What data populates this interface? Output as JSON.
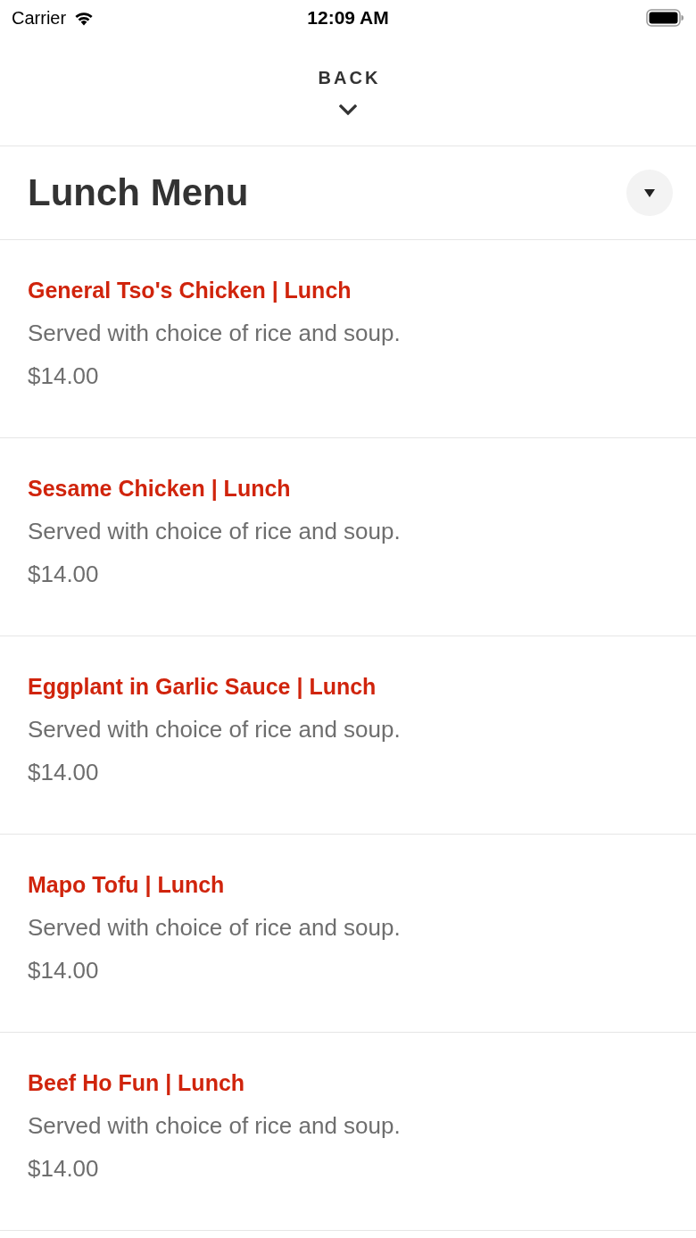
{
  "status_bar": {
    "carrier": "Carrier",
    "time": "12:09 AM"
  },
  "back": {
    "label": "BACK"
  },
  "header": {
    "title": "Lunch Menu"
  },
  "items": [
    {
      "name": "General Tso's Chicken | Lunch",
      "description": "Served with choice of rice and soup.",
      "price": "$14.00"
    },
    {
      "name": "Sesame Chicken | Lunch",
      "description": "Served with choice of rice and soup.",
      "price": "$14.00"
    },
    {
      "name": "Eggplant in Garlic Sauce | Lunch",
      "description": "Served with choice of rice and soup.",
      "price": "$14.00"
    },
    {
      "name": "Mapo Tofu | Lunch",
      "description": "Served with choice of rice and soup.",
      "price": "$14.00"
    },
    {
      "name": "Beef Ho Fun | Lunch",
      "description": "Served with choice of rice and soup.",
      "price": "$14.00"
    }
  ]
}
